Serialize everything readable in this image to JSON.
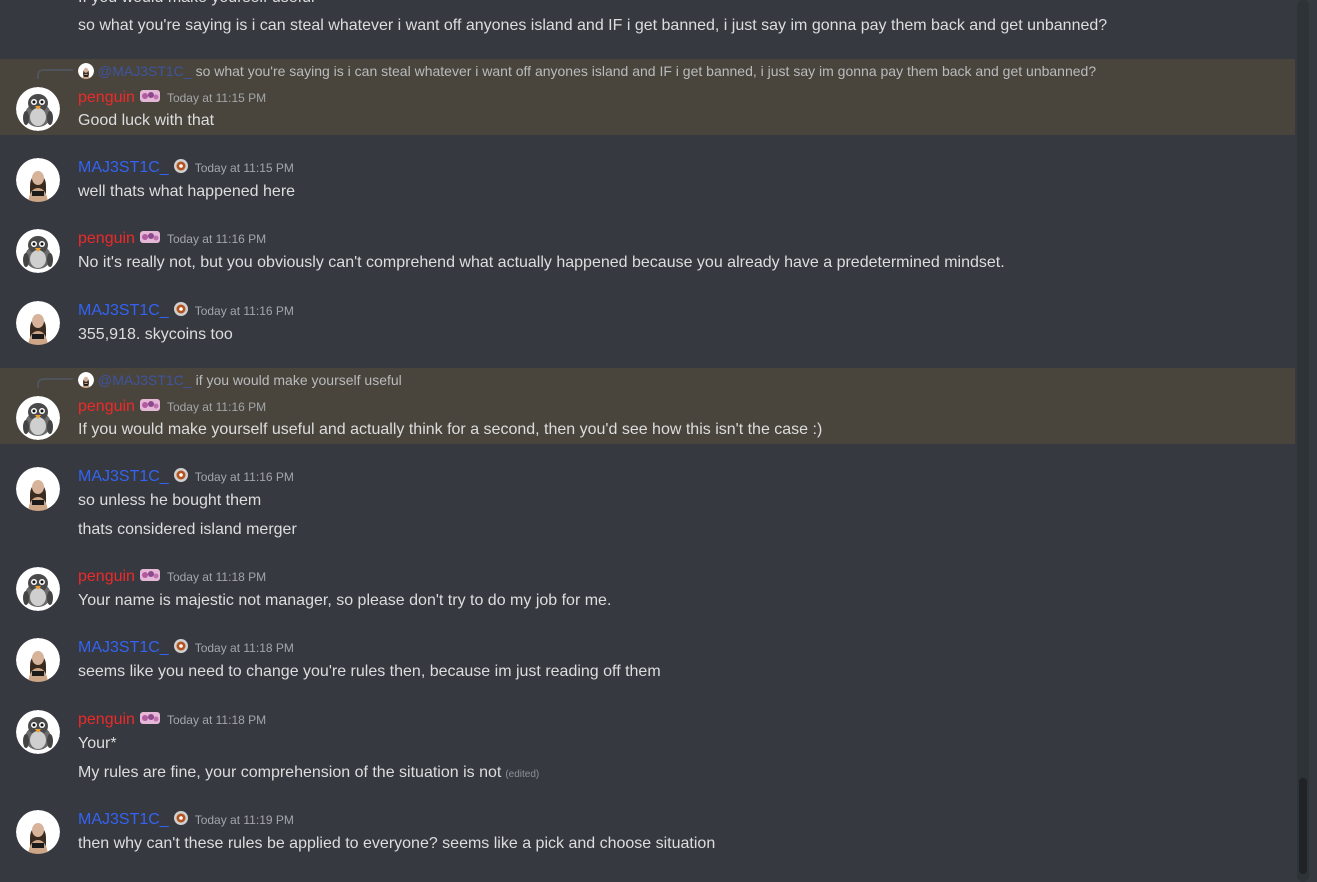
{
  "top_partial": "If you would make yourself useful",
  "top_line": "so what you're saying is i can steal whatever i want off anyones island and IF i get banned, i just say im gonna pay them back and get unbanned?",
  "users": {
    "penguin": "penguin",
    "majestic": "MAJ3ST1C_"
  },
  "messages": [
    {
      "reply": {
        "name": "@MAJ3ST1C_",
        "text": "so what you're saying is i can steal whatever i want off anyones island and IF i get banned, i just say im gonna pay them back and get unbanned?"
      },
      "author": "penguin",
      "time": "Today at 11:15 PM",
      "lines": [
        "Good luck with that"
      ]
    },
    {
      "author": "MAJ3ST1C_",
      "time": "Today at 11:15 PM",
      "lines": [
        "well thats what happened here"
      ]
    },
    {
      "author": "penguin",
      "time": "Today at 11:16 PM",
      "lines": [
        "No it's really not, but you obviously can't comprehend what actually happened because you already have a predetermined mindset."
      ]
    },
    {
      "author": "MAJ3ST1C_",
      "time": "Today at 11:16 PM",
      "lines": [
        "355,918. skycoins too"
      ]
    },
    {
      "reply": {
        "name": "@MAJ3ST1C_",
        "text": "if you would make yourself useful"
      },
      "author": "penguin",
      "time": "Today at 11:16 PM",
      "lines": [
        "If you would make yourself useful and actually think for a second, then you'd see how this isn't the case :)"
      ]
    },
    {
      "author": "MAJ3ST1C_",
      "time": "Today at 11:16 PM",
      "lines": [
        "so unless he bought them",
        "thats considered island merger"
      ]
    },
    {
      "author": "penguin",
      "time": "Today at 11:18 PM",
      "lines": [
        "Your name is majestic not manager, so please don't try to do my job for me."
      ]
    },
    {
      "author": "MAJ3ST1C_",
      "time": "Today at 11:18 PM",
      "lines": [
        "seems like you need to change you're rules then, because im just reading off them"
      ]
    },
    {
      "author": "penguin",
      "time": "Today at 11:18 PM",
      "lines": [
        "Your*",
        "My rules are fine, your comprehension of the situation is not"
      ],
      "edited": "(edited)"
    },
    {
      "author": "MAJ3ST1C_",
      "time": "Today at 11:19 PM",
      "lines": [
        "then why can't these rules be applied to everyone? seems like a pick and choose situation"
      ]
    }
  ],
  "colors": {
    "background": "#36393f",
    "highlight": "#49443c",
    "penguin": "#ed2a2a",
    "majestic": "#3463f3",
    "timestamp": "#a3a6aa"
  },
  "icons": {
    "penguin_avatar": "penguin-avatar",
    "majestic_avatar": "user-photo-avatar",
    "penguin_badge": "emoji-badge-icon",
    "majestic_badge": "emoji-badge-icon"
  }
}
